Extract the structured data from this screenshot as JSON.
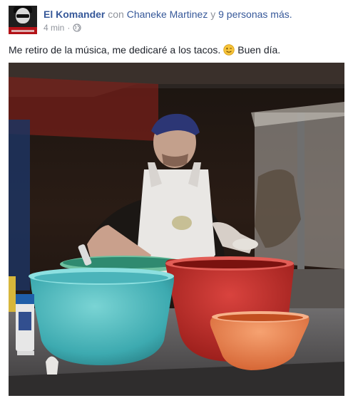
{
  "post": {
    "author": "El Komander",
    "with_word": "con",
    "tagged_person": "Chaneke Martinez",
    "and_word": "y",
    "others": "9 personas más.",
    "time": "4 min",
    "separator": "·",
    "privacy_icon": "globe-icon",
    "message_before_emoji": "Me retiro de la música, me dedicaré a los tacos.",
    "emoji": "wink-emoji-icon",
    "message_after_emoji": "Buen día."
  },
  "colors": {
    "link": "#365899",
    "muted": "#90949c",
    "text": "#1d2129"
  }
}
